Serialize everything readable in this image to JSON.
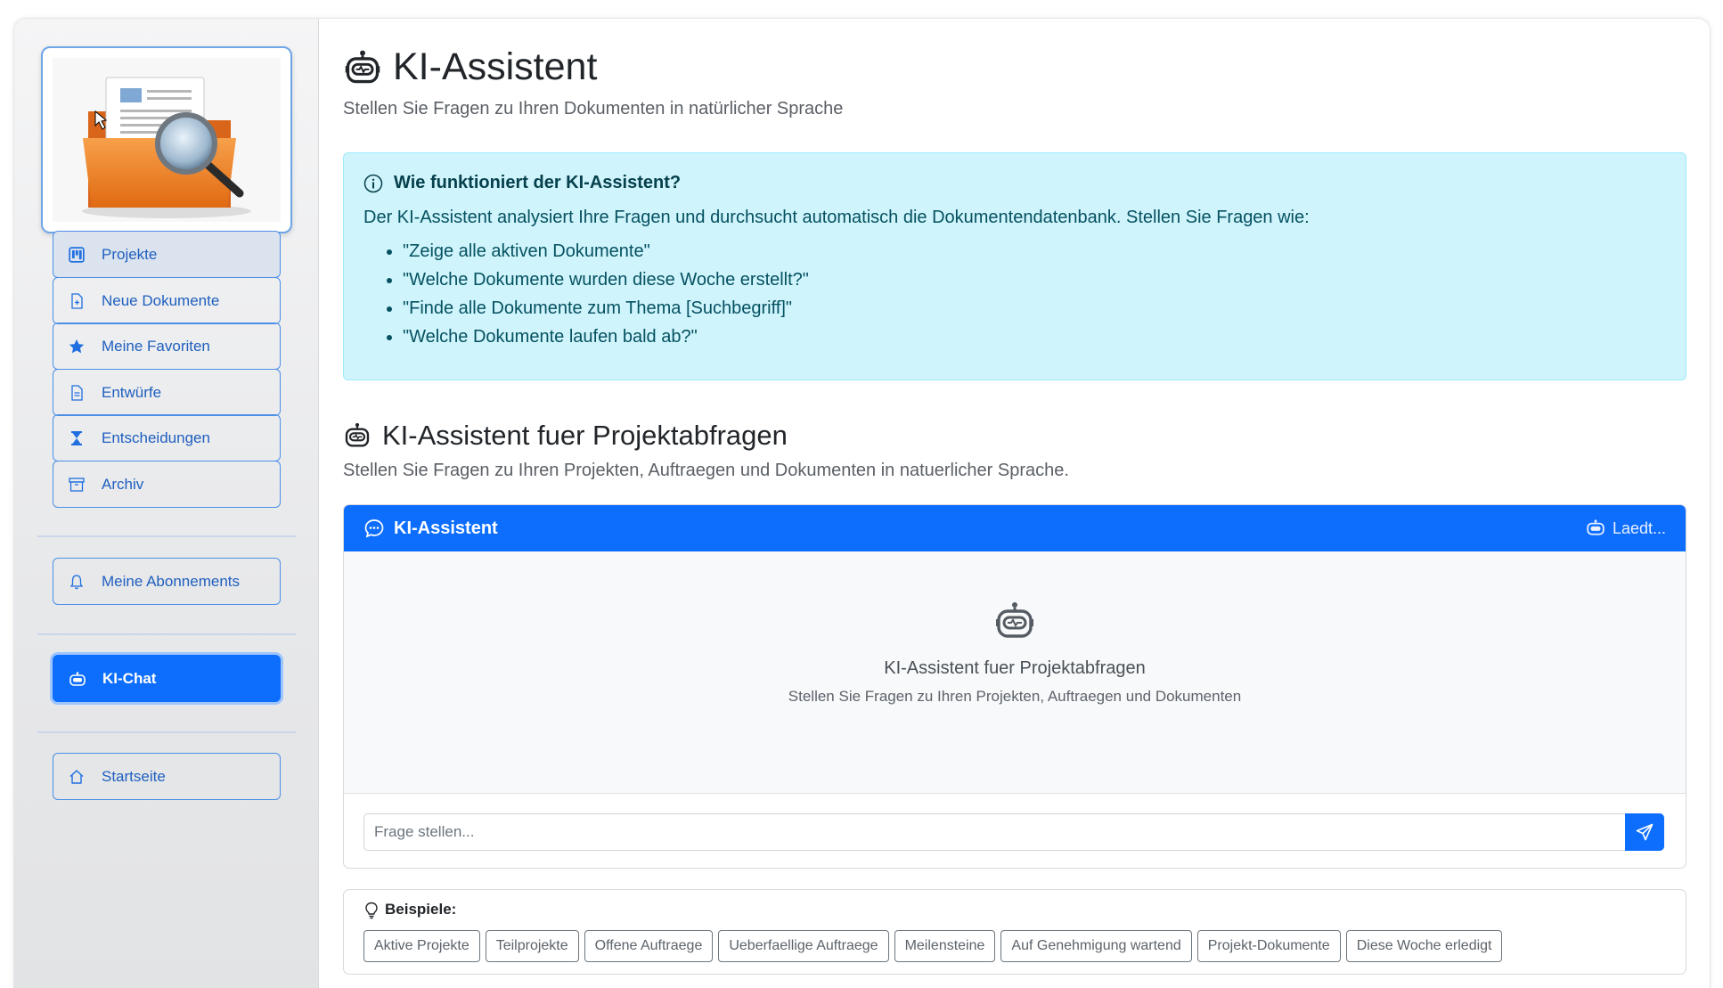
{
  "sidebar": {
    "nav": [
      {
        "label": "Projekte",
        "icon": "kanban-icon"
      },
      {
        "label": "Neue Dokumente",
        "icon": "file-plus-icon"
      },
      {
        "label": "Meine Favoriten",
        "icon": "star-icon"
      },
      {
        "label": "Entwürfe",
        "icon": "file-text-icon"
      },
      {
        "label": "Entscheidungen",
        "icon": "hourglass-icon"
      },
      {
        "label": "Archiv",
        "icon": "archive-icon"
      }
    ],
    "subscriptions": {
      "label": "Meine Abonnements",
      "icon": "bell-icon"
    },
    "ki_chat": {
      "label": "KI-Chat",
      "icon": "robot-icon"
    },
    "home": {
      "label": "Startseite",
      "icon": "house-icon"
    }
  },
  "header": {
    "title": "KI-Assistent",
    "subtitle": "Stellen Sie Fragen zu Ihren Dokumenten in natürlicher Sprache"
  },
  "info": {
    "heading": "Wie funktioniert der KI-Assistent?",
    "text": "Der KI-Assistent analysiert Ihre Fragen und durchsucht automatisch die Dokumentendatenbank. Stellen Sie Fragen wie:",
    "examples": [
      "\"Zeige alle aktiven Dokumente\"",
      "\"Welche Dokumente wurden diese Woche erstellt?\"",
      "\"Finde alle Dokumente zum Thema [Suchbegriff]\"",
      "\"Welche Dokumente laufen bald ab?\""
    ]
  },
  "section": {
    "title": "KI-Assistent fuer Projektabfragen",
    "subtitle": "Stellen Sie Fragen zu Ihren Projekten, Auftraegen und Dokumenten in natuerlicher Sprache."
  },
  "chat": {
    "title": "KI-Assistent",
    "status": "Laedt...",
    "empty_title": "KI-Assistent fuer Projektabfragen",
    "empty_subtitle": "Stellen Sie Fragen zu Ihren Projekten, Auftraegen und Dokumenten",
    "input_placeholder": "Frage stellen..."
  },
  "examples": {
    "label": "Beispiele:",
    "chips": [
      "Aktive Projekte",
      "Teilprojekte",
      "Offene Auftraege",
      "Ueberfaellige Auftraege",
      "Meilensteine",
      "Auf Genehmigung wartend",
      "Projekt-Dokumente",
      "Diese Woche erledigt"
    ]
  },
  "colors": {
    "primary": "#0d6efd",
    "info_bg": "#cff4fc",
    "info_text": "#055160"
  }
}
